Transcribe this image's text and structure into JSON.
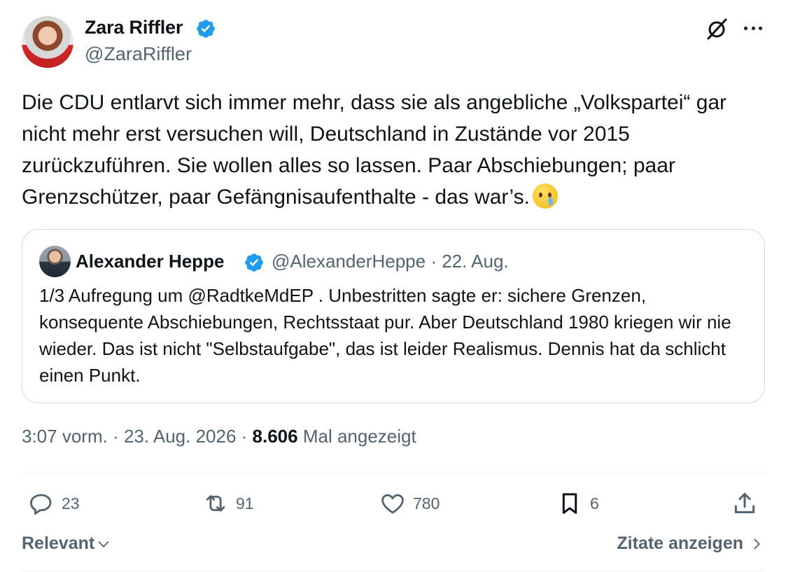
{
  "author": {
    "name": "Zara Riffler",
    "handle": "@ZaraRiffler"
  },
  "tweet": {
    "text": "Die CDU entlarvt sich immer mehr, dass sie als angebliche „Volkspartei“ gar nicht mehr erst versuchen will, Deutschland in Zustände vor 2015 zurückzuführen. Sie wollen alles so lassen. Paar Abschiebungen; paar Grenzschützer, paar Gefängnisaufenthalte - das war’s.",
    "emoji": "crying-face"
  },
  "quote": {
    "name": "Alexander Heppe",
    "handle": "@AlexanderHeppe",
    "date": "22. Aug.",
    "text": "1/3 Aufregung um @RadtkeMdEP . Unbestritten sagte er: sichere Grenzen, konsequente Abschiebungen, Rechtsstaat pur. Aber Deutschland 1980 kriegen wir nie wieder. Das ist nicht \"Selbstaufgabe\", das ist leider Realismus. Dennis hat da schlicht einen Punkt."
  },
  "meta": {
    "time": "3:07 vorm.",
    "date": "23. Aug. 2026",
    "views": "8.606",
    "views_label": "Mal angezeigt"
  },
  "actions": {
    "replies": "23",
    "reposts": "91",
    "likes": "780",
    "bookmarks": "6"
  },
  "footer": {
    "sort_label": "Relevant",
    "quotes_label": "Zitate anzeigen"
  },
  "colors": {
    "verified": "#1d9bf0",
    "secondary_text": "#536471",
    "primary_text": "#0f1419",
    "border": "#cfd9de"
  }
}
